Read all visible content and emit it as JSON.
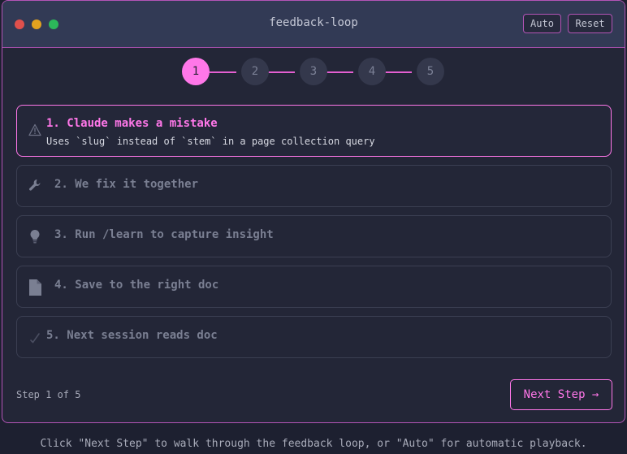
{
  "window": {
    "title": "feedback-loop",
    "traffic_lights": [
      "#e0504c",
      "#e2a21f",
      "#2cb85a"
    ],
    "auto_label": "Auto",
    "reset_label": "Reset"
  },
  "stepper": {
    "current": 1,
    "steps": [
      "1",
      "2",
      "3",
      "4",
      "5"
    ]
  },
  "cards": [
    {
      "icon": "warning-icon",
      "title": "1. Claude makes a mistake",
      "description": "Uses `slug` instead of `stem` in a page collection query"
    },
    {
      "icon": "wrench-icon",
      "title": "2. We fix it together",
      "description": ""
    },
    {
      "icon": "lightbulb-icon",
      "title": "3. Run /learn to capture insight",
      "description": ""
    },
    {
      "icon": "document-icon",
      "title": "4. Save to the right doc",
      "description": ""
    },
    {
      "icon": "checkmark-icon",
      "title": "5. Next session reads doc",
      "description": ""
    }
  ],
  "footer": {
    "status": "Step 1 of 5",
    "next_label": "Next Step →"
  },
  "caption": "Click \"Next Step\" to walk through the feedback loop, or \"Auto\" for automatic playback.",
  "colors": {
    "accent": "#ff77e9",
    "background": "#1d2030",
    "panel": "#232637",
    "titlebar": "#323a55"
  }
}
